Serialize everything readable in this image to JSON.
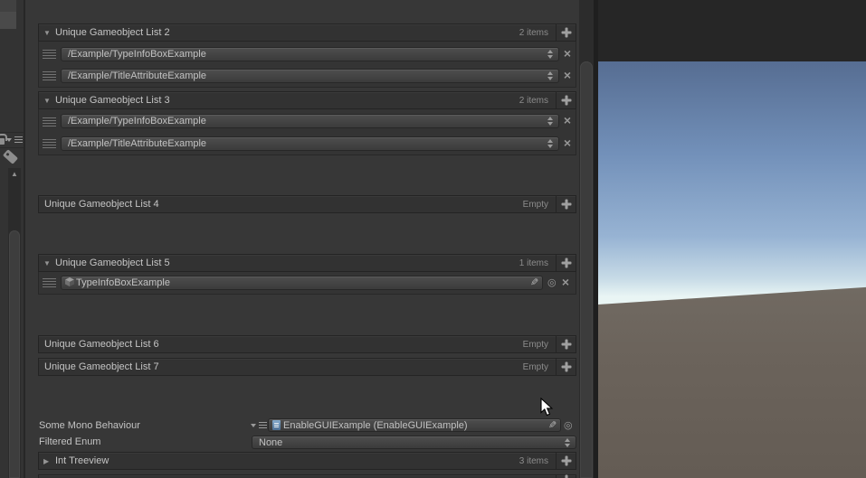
{
  "inspector": {
    "lists": [
      {
        "label": "Unique Gameobject List 2",
        "count": "2 items",
        "items": [
          "/Example/TypeInfoBoxExample",
          "/Example/TitleAttributeExample"
        ]
      },
      {
        "label": "Unique Gameobject List 3",
        "count": "2 items",
        "items": [
          "/Example/TypeInfoBoxExample",
          "/Example/TitleAttributeExample"
        ]
      },
      {
        "label": "Unique Gameobject List 4",
        "count": "Empty",
        "items": []
      },
      {
        "label": "Unique Gameobject List 5",
        "count": "1 items",
        "object_item": "TypeInfoBoxExample"
      },
      {
        "label": "Unique Gameobject List 6",
        "count": "Empty",
        "items": []
      },
      {
        "label": "Unique Gameobject List 7",
        "count": "Empty",
        "items": []
      }
    ],
    "fields": {
      "mono_label": "Some Mono Behaviour",
      "mono_value": "EnableGUIExample (EnableGUIExample)",
      "enum_label": "Filtered Enum",
      "enum_value": "None"
    },
    "treeview": {
      "label": "Int Treeview",
      "count": "3 items"
    }
  },
  "glyphs": {
    "foldout_open": "▼",
    "foldout_closed": "▶",
    "remove": "×",
    "object_picker": "◎",
    "edit_pen": "✎",
    "scroll_up": "▲"
  },
  "colors": {
    "panel_bg": "#383838",
    "header_bg": "#323232",
    "field_text": "#c2c2c2",
    "sky_top": "#566d92",
    "sky_horizon": "#eef7f4",
    "ground": "#6a6259",
    "script_icon_blue": "#6b93b8"
  }
}
